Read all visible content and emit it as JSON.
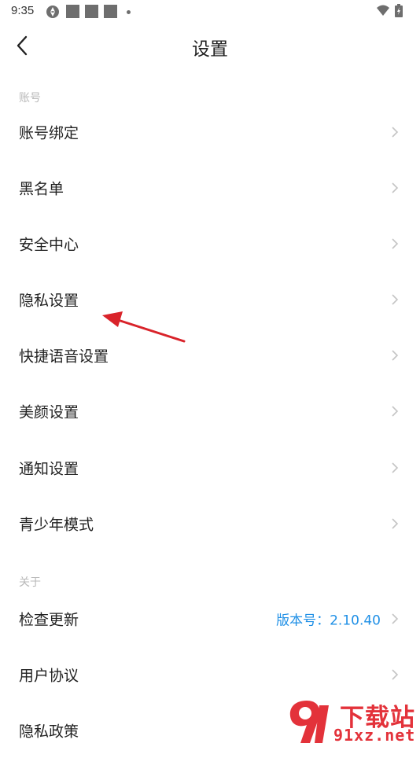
{
  "status_bar": {
    "time": "9:35"
  },
  "header": {
    "title": "设置"
  },
  "sections": [
    {
      "label": "账号",
      "items": [
        {
          "label": "账号绑定"
        },
        {
          "label": "黑名单"
        },
        {
          "label": "安全中心"
        },
        {
          "label": "隐私设置"
        },
        {
          "label": "快捷语音设置"
        },
        {
          "label": "美颜设置"
        },
        {
          "label": "通知设置"
        },
        {
          "label": "青少年模式"
        }
      ]
    },
    {
      "label": "关于",
      "items": [
        {
          "label": "检查更新",
          "value": "版本号：2.10.40"
        },
        {
          "label": "用户协议"
        },
        {
          "label": "隐私政策"
        }
      ]
    }
  ],
  "watermark": {
    "title": "下载站",
    "domain": "91xz.net"
  },
  "colors": {
    "accent": "#1e8fe6",
    "section_label": "#b8b8b8",
    "annotation_arrow": "#d9232a",
    "watermark": "#e3323a"
  }
}
